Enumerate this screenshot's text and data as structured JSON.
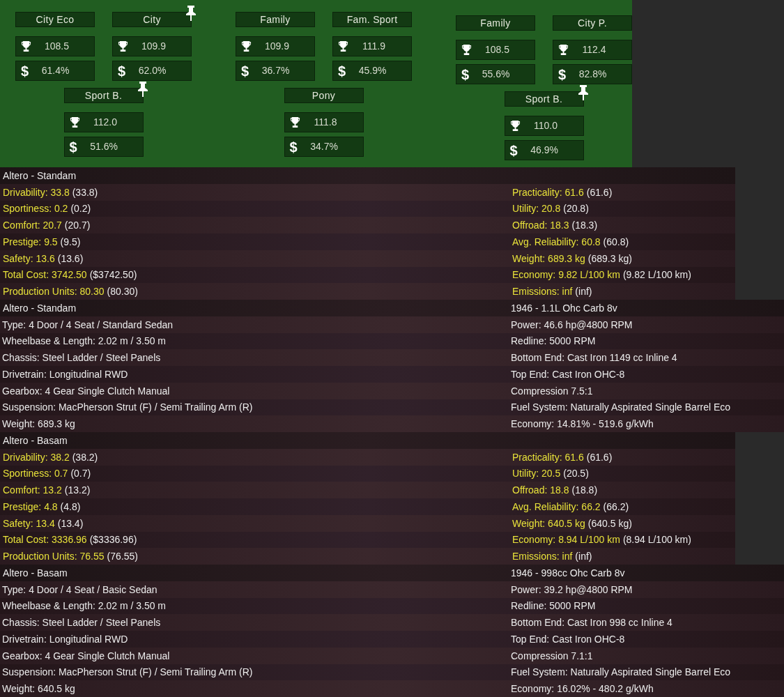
{
  "segments": [
    {
      "cards": [
        {
          "title": "City Eco",
          "pinned": false,
          "score": "108.5",
          "currency": "$",
          "share": "61.4%"
        },
        {
          "title": "City",
          "pinned": true,
          "score": "109.9",
          "currency": "$",
          "share": "62.0%"
        }
      ],
      "sub": {
        "title": "Sport B.",
        "pinned": true,
        "score": "112.0",
        "currency": "$",
        "share": "51.6%"
      }
    },
    {
      "cards": [
        {
          "title": "Family",
          "pinned": false,
          "score": "109.9",
          "currency": "$",
          "share": "36.7%"
        },
        {
          "title": "Fam. Sport",
          "pinned": false,
          "score": "111.9",
          "currency": "$",
          "share": "45.9%"
        }
      ],
      "sub": {
        "title": "Pony",
        "pinned": false,
        "score": "111.8",
        "currency": "$",
        "share": "34.7%"
      }
    },
    {
      "cards": [
        {
          "title": "Family",
          "pinned": false,
          "score": "108.5",
          "currency": "$",
          "share": "55.6%"
        },
        {
          "title": "City P.",
          "pinned": false,
          "score": "112.4",
          "currency": "$",
          "share": "82.8%"
        }
      ],
      "sub": {
        "title": "Sport B.",
        "pinned": true,
        "score": "110.0",
        "currency": "$",
        "share": "46.9%"
      }
    }
  ],
  "panels": [
    {
      "kind": "stats",
      "title": "Altero - Standam",
      "left": [
        {
          "text": "Drivability: 33.8",
          "note": "(33.8)"
        },
        {
          "text": "Sportiness: 0.2",
          "note": "(0.2)"
        },
        {
          "text": "Comfort: 20.7",
          "note": "(20.7)"
        },
        {
          "text": "Prestige: 9.5",
          "note": "(9.5)"
        },
        {
          "text": "Safety: 13.6",
          "note": "(13.6)"
        },
        {
          "text": "Total Cost: 3742.50",
          "note": "($3742.50)"
        },
        {
          "text": "Production Units: 80.30",
          "note": "(80.30)"
        }
      ],
      "right": [
        {
          "text": "Practicality: 61.6",
          "note": "(61.6)"
        },
        {
          "text": "Utility: 20.8",
          "note": "(20.8)"
        },
        {
          "text": "Offroad: 18.3",
          "note": "(18.3)"
        },
        {
          "text": "Avg. Reliability: 60.8",
          "note": "(60.8)"
        },
        {
          "text": "Weight: 689.3 kg",
          "note": "(689.3 kg)"
        },
        {
          "text": "Economy: 9.82 L/100 km",
          "note": "(9.82 L/100 km)"
        },
        {
          "text": "Emissions: inf",
          "note": "(inf)"
        }
      ]
    },
    {
      "kind": "specs",
      "title": "Altero - Standam",
      "right_title": "1946 - 1.1L Ohc Carb 8v",
      "left": [
        "Type: 4 Door / 4 Seat / Standard Sedan",
        "Wheelbase & Length: 2.02 m / 3.50 m",
        "Chassis: Steel Ladder / Steel Panels",
        "Drivetrain: Longitudinal RWD",
        "Gearbox: 4 Gear Single Clutch Manual",
        "Suspension: MacPherson Strut (F) / Semi Trailing Arm (R)",
        "Weight: 689.3 kg"
      ],
      "right": [
        "Power: 46.6 hp@4800 RPM",
        "Redline: 5000 RPM",
        "Bottom End: Cast Iron 1149 cc Inline 4",
        "Top End: Cast Iron OHC-8",
        "Compression 7.5:1",
        "Fuel System: Naturally Aspirated Single Barrel Eco",
        "Economy: 14.81% - 519.6 g/kWh"
      ]
    },
    {
      "kind": "stats",
      "title": "Altero - Basam",
      "left": [
        {
          "text": "Drivability: 38.2",
          "note": "(38.2)"
        },
        {
          "text": "Sportiness: 0.7",
          "note": "(0.7)"
        },
        {
          "text": "Comfort: 13.2",
          "note": "(13.2)"
        },
        {
          "text": "Prestige: 4.8",
          "note": "(4.8)"
        },
        {
          "text": "Safety: 13.4",
          "note": "(13.4)"
        },
        {
          "text": "Total Cost: 3336.96",
          "note": "($3336.96)"
        },
        {
          "text": "Production Units: 76.55",
          "note": "(76.55)"
        }
      ],
      "right": [
        {
          "text": "Practicality: 61.6",
          "note": "(61.6)"
        },
        {
          "text": "Utility: 20.5",
          "note": "(20.5)"
        },
        {
          "text": "Offroad: 18.8",
          "note": "(18.8)"
        },
        {
          "text": "Avg. Reliability: 66.2",
          "note": "(66.2)"
        },
        {
          "text": "Weight: 640.5 kg",
          "note": "(640.5 kg)"
        },
        {
          "text": "Economy: 8.94 L/100 km",
          "note": "(8.94 L/100 km)"
        },
        {
          "text": "Emissions: inf",
          "note": "(inf)"
        }
      ]
    },
    {
      "kind": "specs",
      "title": "Altero - Basam",
      "right_title": "1946 - 998cc Ohc Carb 8v",
      "left": [
        "Type: 4 Door / 4 Seat / Basic Sedan",
        "Wheelbase & Length: 2.02 m / 3.50 m",
        "Chassis: Steel Ladder / Steel Panels",
        "Drivetrain: Longitudinal RWD",
        "Gearbox: 4 Gear Single Clutch Manual",
        "Suspension: MacPherson Strut (F) / Semi Trailing Arm (R)",
        "Weight: 640.5 kg"
      ],
      "right": [
        "Power: 39.2 hp@4800 RPM",
        "Redline: 5000 RPM",
        "Bottom End: Cast Iron 998 cc Inline 4",
        "Top End: Cast Iron OHC-8",
        "Compression 7.1:1",
        "Fuel System: Naturally Aspirated Single Barrel Eco",
        "Economy: 16.02% - 480.2 g/kWh"
      ]
    }
  ]
}
